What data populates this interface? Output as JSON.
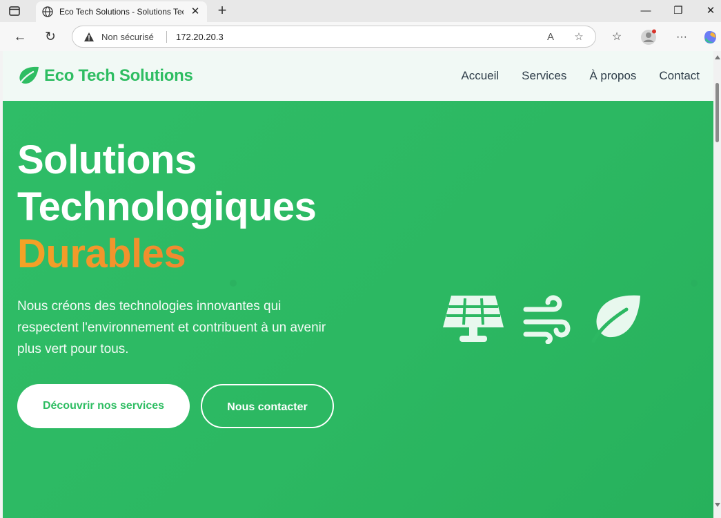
{
  "browser": {
    "tab_title": "Eco Tech Solutions - Solutions Tec",
    "security_label": "Non sécurisé",
    "url": "172.20.20.3"
  },
  "site": {
    "brand": "Eco Tech Solutions",
    "brand_color": "#2ebd62",
    "nav": [
      {
        "label": "Accueil"
      },
      {
        "label": "Services"
      },
      {
        "label": "À propos"
      },
      {
        "label": "Contact"
      }
    ]
  },
  "hero": {
    "title_line1": "Solutions",
    "title_line2": "Technologiques",
    "title_accent": "Durables",
    "description": "Nous créons des technologies innovantes qui respectent l'environnement et contribuent à un avenir plus vert pour tous.",
    "primary_button": "Découvrir nos services",
    "secondary_button": "Nous contacter",
    "background_color": "#2cb862",
    "icons": [
      "solar-panel-icon",
      "wind-icon",
      "leaf-icon"
    ]
  }
}
